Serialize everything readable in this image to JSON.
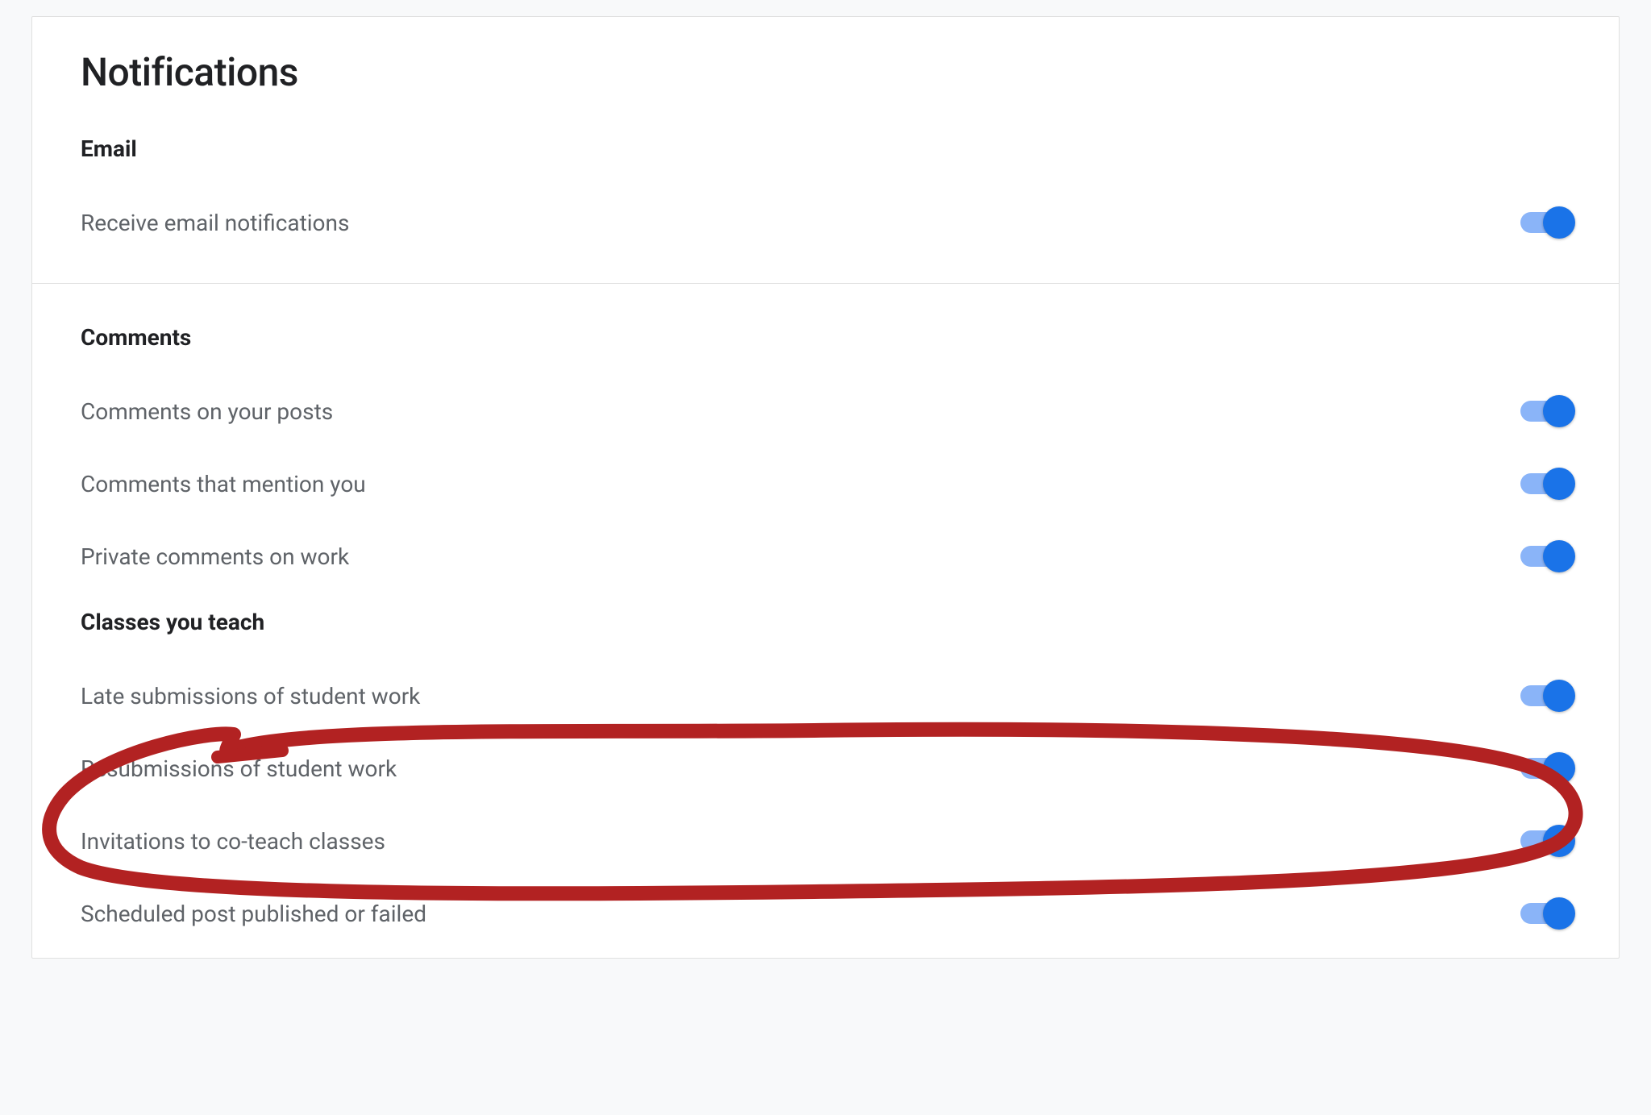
{
  "page": {
    "title": "Notifications"
  },
  "sections": {
    "email": {
      "header": "Email",
      "items": [
        {
          "label": "Receive email notifications",
          "on": true
        }
      ]
    },
    "comments": {
      "header": "Comments",
      "items": [
        {
          "label": "Comments on your posts",
          "on": true
        },
        {
          "label": "Comments that mention you",
          "on": true
        },
        {
          "label": "Private comments on work",
          "on": true
        }
      ]
    },
    "classes": {
      "header": "Classes you teach",
      "items": [
        {
          "label": "Late submissions of student work",
          "on": true
        },
        {
          "label": "Resubmissions of student work",
          "on": true
        },
        {
          "label": "Invitations to co-teach classes",
          "on": true
        },
        {
          "label": "Scheduled post published or failed",
          "on": true
        }
      ]
    }
  },
  "annotation": {
    "color": "#b22222",
    "target": "late-submissions"
  }
}
